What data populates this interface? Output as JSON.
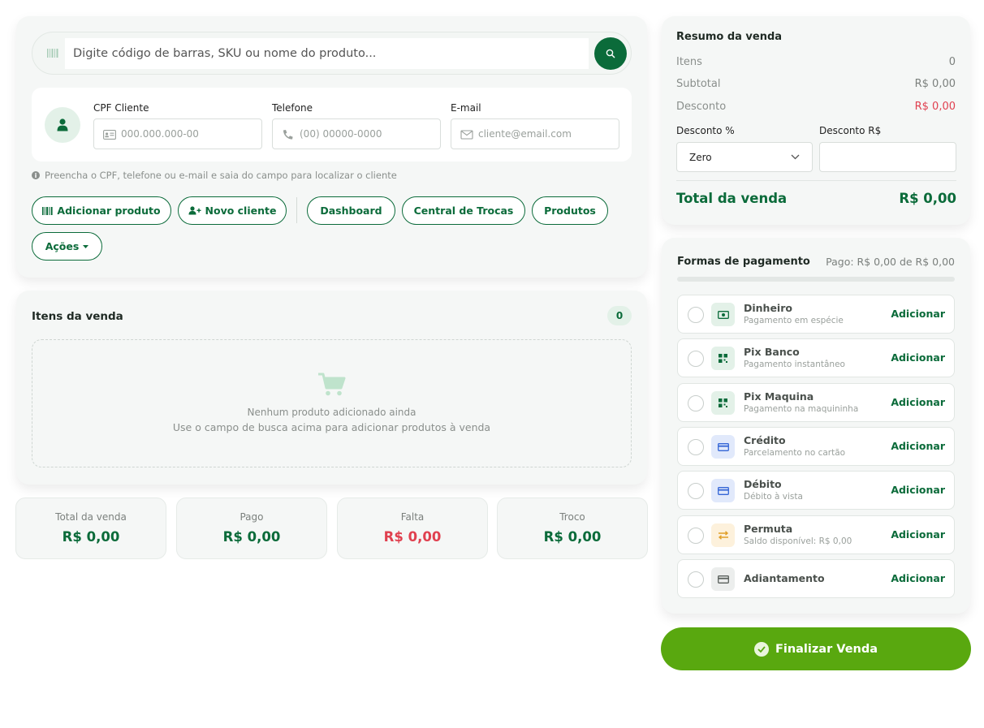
{
  "search": {
    "placeholder": "Digite código de barras, SKU ou nome do produto..."
  },
  "client": {
    "cpf_label": "CPF Cliente",
    "cpf_placeholder": "000.000.000-00",
    "phone_label": "Telefone",
    "phone_placeholder": "(00) 00000-0000",
    "email_label": "E-mail",
    "email_placeholder": "cliente@email.com",
    "hint": "Preencha o CPF, telefone ou e-mail e saia do campo para localizar o cliente"
  },
  "actions": {
    "add_product": "Adicionar produto",
    "new_client": "Novo cliente",
    "dashboard": "Dashboard",
    "exchange_center": "Central de Trocas",
    "products": "Produtos",
    "actions": "Ações"
  },
  "items": {
    "title": "Itens da venda",
    "count": "0",
    "empty_title": "Nenhum produto adicionado ainda",
    "empty_subtitle": "Use o campo de busca acima para adicionar produtos à venda"
  },
  "stats": [
    {
      "label": "Total da venda",
      "value": "R$ 0,00",
      "color": "#0b6b3a"
    },
    {
      "label": "Pago",
      "value": "R$ 0,00",
      "color": "#0b6b3a"
    },
    {
      "label": "Falta",
      "value": "R$ 0,00",
      "color": "#e0404f"
    },
    {
      "label": "Troco",
      "value": "R$ 0,00",
      "color": "#0b6b3a"
    }
  ],
  "summary": {
    "title": "Resumo da venda",
    "items_label": "Itens",
    "items_value": "0",
    "subtotal_label": "Subtotal",
    "subtotal_value": "R$ 0,00",
    "discount_label": "Desconto",
    "discount_value": "R$ 0,00",
    "discount_pct_label": "Desconto %",
    "discount_pct_selected": "Zero",
    "discount_rs_label": "Desconto R$",
    "total_label": "Total da venda",
    "total_value": "R$ 0,00"
  },
  "payment": {
    "title": "Formas de pagamento",
    "paid_text": "Pago: R$ 0,00 de R$ 0,00",
    "progress": 0,
    "add_label": "Adicionar",
    "methods": [
      {
        "name": "Dinheiro",
        "desc": "Pagamento em espécie",
        "icon": "cash-icon"
      },
      {
        "name": "Pix Banco",
        "desc": "Pagamento instantâneo",
        "icon": "qr-code-icon"
      },
      {
        "name": "Pix Maquina",
        "desc": "Pagamento na maquininha",
        "icon": "qr-code-icon"
      },
      {
        "name": "Crédito",
        "desc": "Parcelamento no cartão",
        "icon": "credit-card-icon"
      },
      {
        "name": "Débito",
        "desc": "Débito à vista",
        "icon": "credit-card-icon"
      },
      {
        "name": "Permuta",
        "desc": "Saldo disponível: R$ 0,00",
        "icon": "exchange-icon"
      },
      {
        "name": "Adiantamento",
        "desc": "",
        "icon": "card-icon"
      }
    ]
  },
  "finalize_label": "Finalizar Venda"
}
